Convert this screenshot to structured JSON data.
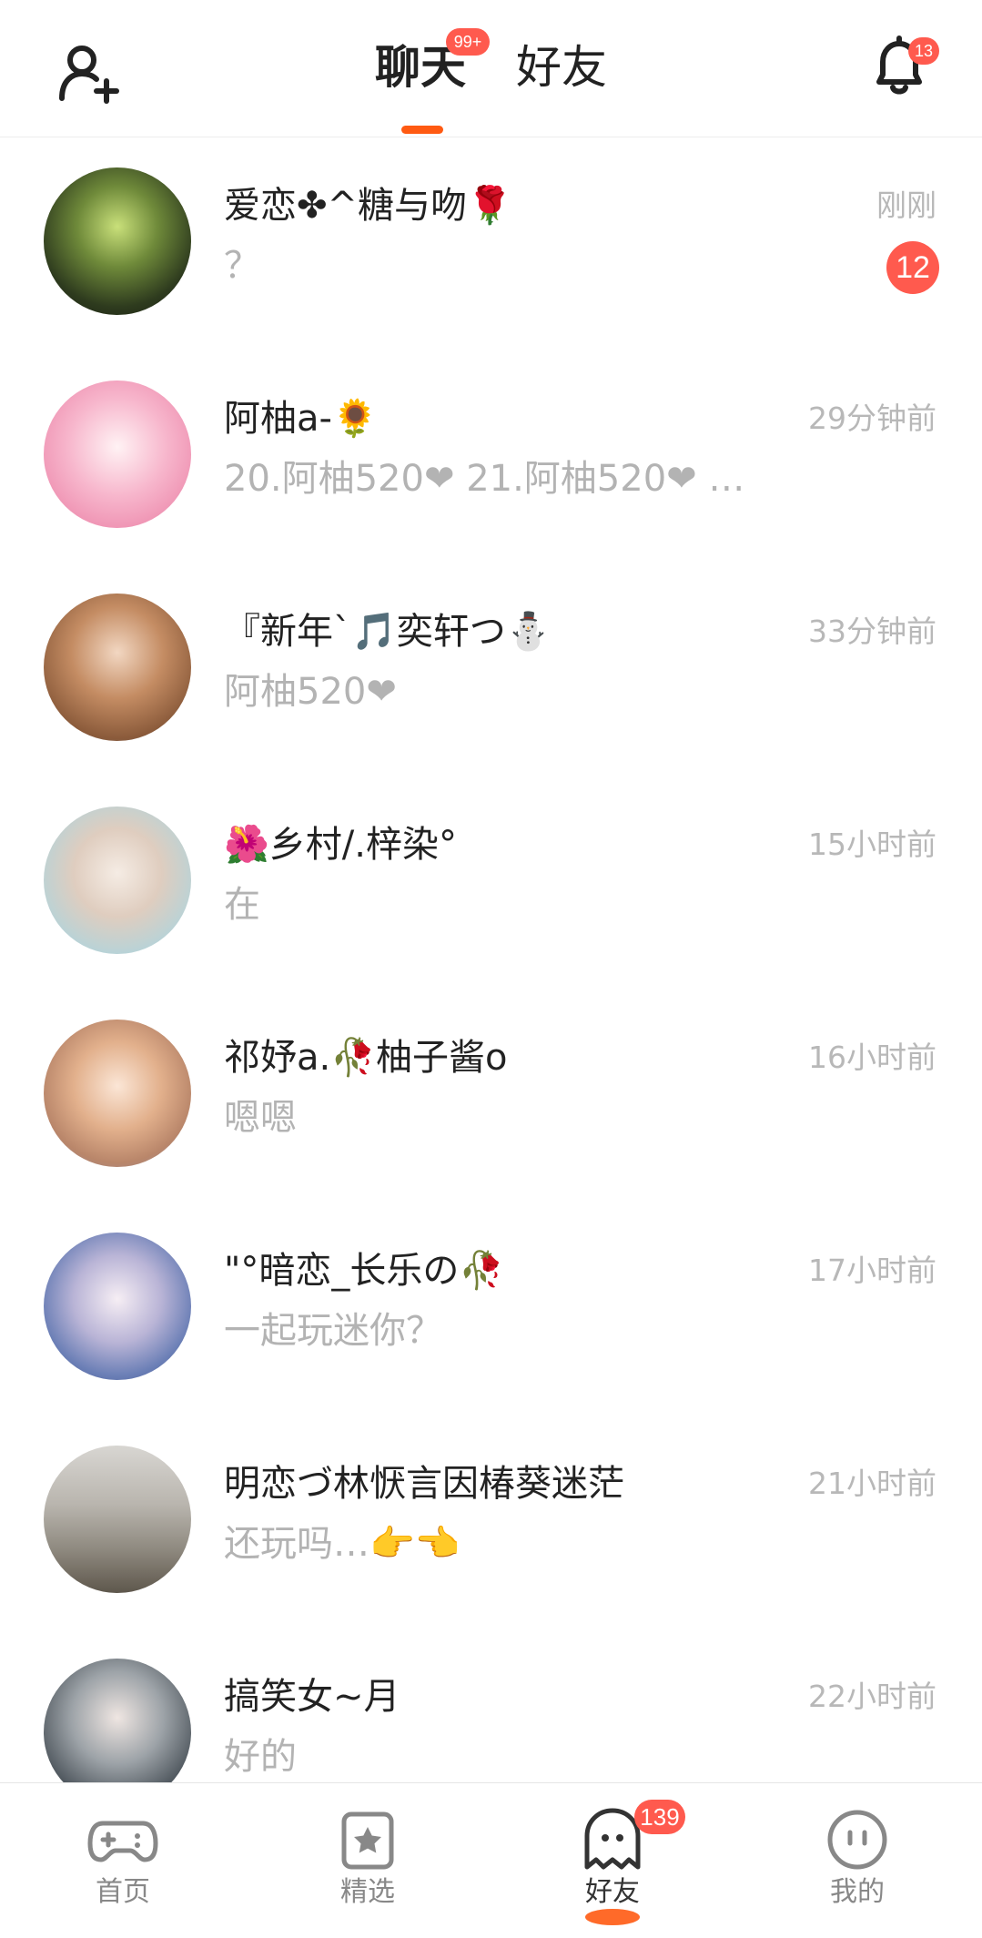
{
  "header": {
    "tabs": [
      {
        "label": "聊天",
        "badge": "99+",
        "active": true
      },
      {
        "label": "好友",
        "active": false
      }
    ],
    "add_friend_icon": "add-user-icon",
    "notification_icon": "bell-icon",
    "notification_badge": "13",
    "accent_color": "#ff5a12",
    "badge_color": "#ff5a4e"
  },
  "chats": [
    {
      "name": "爱恋✤^糖与吻🌹",
      "preview": "？",
      "time": "刚刚",
      "unread": "12"
    },
    {
      "name": "阿柚a-🌻",
      "preview": "20.阿柚520❤ 21.阿柚520❤ …",
      "time": "29分钟前"
    },
    {
      "name": "『新年`🎵奕轩つ⛄",
      "preview": "阿柚520❤",
      "time": "33分钟前"
    },
    {
      "name": "🌺乡村/.梓染°",
      "preview": "在",
      "time": "15小时前"
    },
    {
      "name": "祁妤a.🥀柚子酱o",
      "preview": "嗯嗯",
      "time": "16小时前"
    },
    {
      "name": "\"°暗恋_长乐の🥀",
      "preview": "一起玩迷你？",
      "time": "17小时前"
    },
    {
      "name": "明恋づ林恹言因椿葵迷茫",
      "preview": "还玩吗…👉👈",
      "time": "21小时前"
    },
    {
      "name": "搞笑女~月",
      "preview": "好的",
      "time": "22小时前"
    }
  ],
  "bottom_nav": {
    "items": [
      {
        "label": "首页",
        "icon": "gamepad-icon"
      },
      {
        "label": "精选",
        "icon": "star-bookmark-icon"
      },
      {
        "label": "好友",
        "icon": "ghost-icon",
        "badge": "139",
        "active": true
      },
      {
        "label": "我的",
        "icon": "face-icon"
      }
    ]
  }
}
